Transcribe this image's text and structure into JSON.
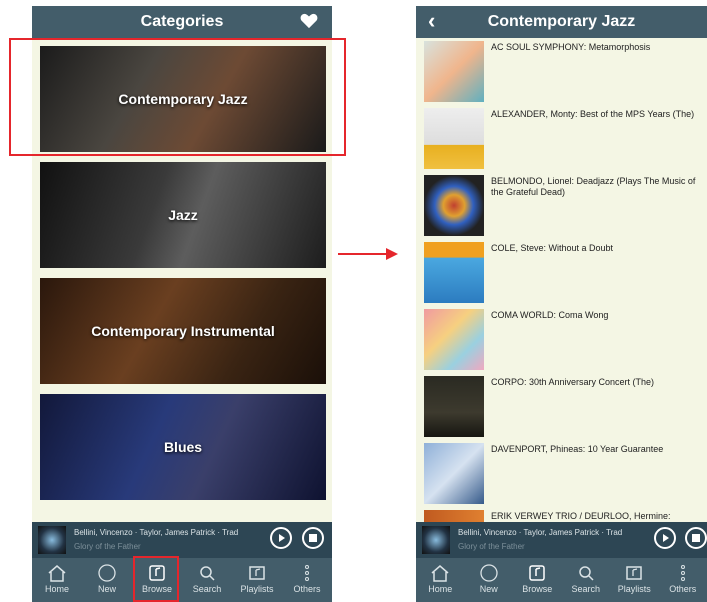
{
  "left": {
    "header_title": "Categories",
    "categories": [
      "Contemporary Jazz",
      "Jazz",
      "Contemporary Instrumental",
      "Blues"
    ]
  },
  "right": {
    "header_title": "Contemporary Jazz",
    "albums": [
      "AC SOUL SYMPHONY: Metamorphosis",
      "ALEXANDER, Monty: Best of the MPS Years (The)",
      "BELMONDO, Lionel: Deadjazz (Plays The Music of the Grateful Dead)",
      "COLE, Steve: Without a Doubt",
      "COMA WORLD: Coma Wong",
      "CORPO: 30th Anniversary Concert (The)",
      "DAVENPORT, Phineas: 10 Year Guarantee",
      "ERIK VERWEY TRIO / DEURLOO, Hermine:"
    ]
  },
  "now_playing": {
    "title": "Bellini, Vincenzo · Taylor, James Patrick · Trad",
    "subtitle": "Glory of the Father"
  },
  "tabs": [
    "Home",
    "New",
    "Browse",
    "Search",
    "Playlists",
    "Others"
  ],
  "colors": {
    "header": "#435d6a",
    "background": "#f4f6e4",
    "highlight": "#e5262c"
  }
}
